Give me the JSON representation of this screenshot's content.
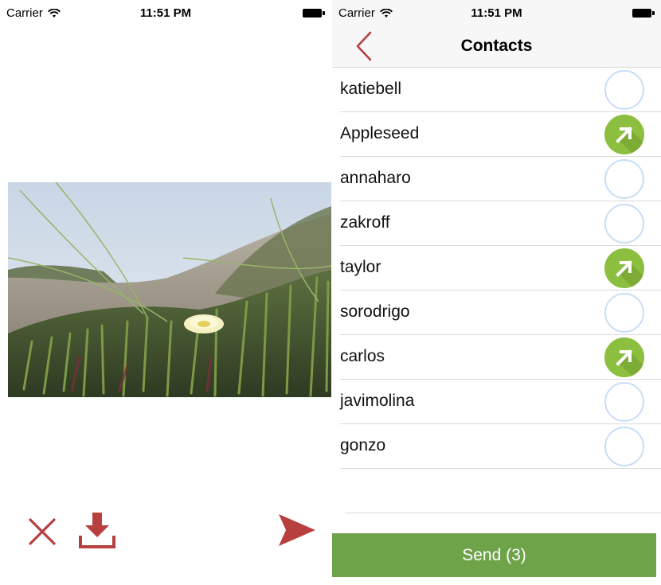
{
  "colors": {
    "accent_red": "#b7403f",
    "green": "#6ea34a",
    "check_green": "#8cbf3f",
    "circle_blue": "#c7def5"
  },
  "left_screen": {
    "status": {
      "carrier": "Carrier",
      "time": "11:51 PM"
    },
    "photo": {
      "icon": "photo-flower-dune"
    },
    "actions": {
      "close_icon": "close-icon",
      "download_icon": "download-icon",
      "send_icon": "send-icon"
    }
  },
  "right_screen": {
    "status": {
      "carrier": "Carrier",
      "time": "11:51 PM"
    },
    "nav": {
      "title": "Contacts",
      "back_icon": "chevron-left-icon"
    },
    "contacts": [
      {
        "name": "katiebell",
        "selected": false
      },
      {
        "name": "Appleseed",
        "selected": true
      },
      {
        "name": "annaharo",
        "selected": false
      },
      {
        "name": "zakroff",
        "selected": false
      },
      {
        "name": "taylor",
        "selected": true
      },
      {
        "name": "sorodrigo",
        "selected": false
      },
      {
        "name": "carlos",
        "selected": true
      },
      {
        "name": "javimolina",
        "selected": false
      },
      {
        "name": "gonzo",
        "selected": false
      }
    ],
    "send_label": "Send (3)"
  }
}
